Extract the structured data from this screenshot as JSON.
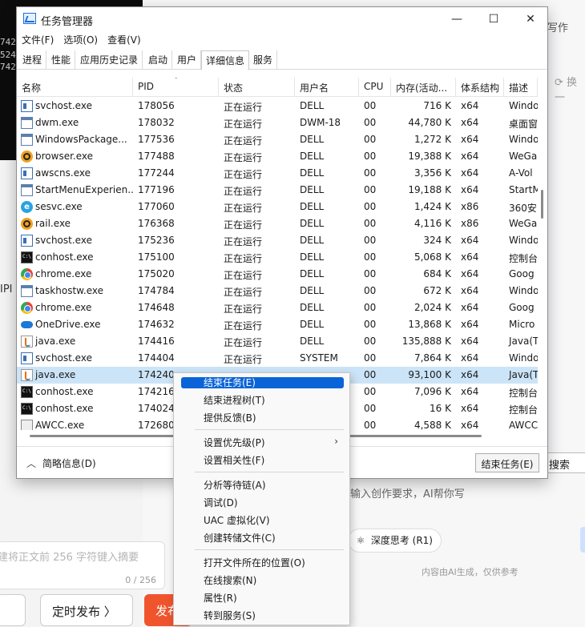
{
  "background": {
    "terminal_lines": [
      "742",
      "5242",
      "742"
    ],
    "write_label": "写作",
    "change_label": "换一",
    "side_text": "IPI",
    "search_label": "搜索",
    "hint": "输入创作要求，AI帮你写",
    "deep_think": "深度思考 (R1)",
    "ai_note": "内容由AI生成，仅供参考",
    "textarea_placeholder": "建将正文前 256 字符键入摘要",
    "textarea_count": "0 / 256",
    "schedule_btn": "定时发布 〉",
    "publish_btn": "发布"
  },
  "window": {
    "title": "任务管理器",
    "minimize": "—",
    "maximize": "☐",
    "close": "✕",
    "menu": [
      "文件(F)",
      "选项(O)",
      "查看(V)"
    ],
    "tabs": [
      "进程",
      "性能",
      "应用历史记录",
      "启动",
      "用户",
      "详细信息",
      "服务"
    ],
    "active_tab": "详细信息"
  },
  "table": {
    "columns": [
      "名称",
      "PID",
      "状态",
      "用户名",
      "CPU",
      "内存(活动...",
      "体系结构",
      "描述"
    ],
    "rows": [
      {
        "icon": "svc",
        "name": "svchost.exe",
        "pid": "178056",
        "status": "正在运行",
        "user": "DELL",
        "cpu": "00",
        "mem": "716 K",
        "arch": "x64",
        "desc": "Windo"
      },
      {
        "icon": "app",
        "name": "dwm.exe",
        "pid": "178032",
        "status": "正在运行",
        "user": "DWM-18",
        "cpu": "00",
        "mem": "44,780 K",
        "arch": "x64",
        "desc": "桌面窗"
      },
      {
        "icon": "app",
        "name": "WindowsPackage...",
        "pid": "177536",
        "status": "正在运行",
        "user": "DELL",
        "cpu": "00",
        "mem": "1,272 K",
        "arch": "x64",
        "desc": "Windo"
      },
      {
        "icon": "browser",
        "name": "browser.exe",
        "pid": "177488",
        "status": "正在运行",
        "user": "DELL",
        "cpu": "00",
        "mem": "19,388 K",
        "arch": "x64",
        "desc": "WeGa"
      },
      {
        "icon": "svc",
        "name": "awscns.exe",
        "pid": "177244",
        "status": "正在运行",
        "user": "DELL",
        "cpu": "00",
        "mem": "3,356 K",
        "arch": "x64",
        "desc": "A-Vol"
      },
      {
        "icon": "app",
        "name": "StartMenuExperien...",
        "pid": "177196",
        "status": "正在运行",
        "user": "DELL",
        "cpu": "00",
        "mem": "19,188 K",
        "arch": "x64",
        "desc": "StartM"
      },
      {
        "icon": "c360",
        "name": "sesvc.exe",
        "pid": "177060",
        "status": "正在运行",
        "user": "DELL",
        "cpu": "00",
        "mem": "1,424 K",
        "arch": "x86",
        "desc": "360安"
      },
      {
        "icon": "browser",
        "name": "rail.exe",
        "pid": "176368",
        "status": "正在运行",
        "user": "DELL",
        "cpu": "00",
        "mem": "4,116 K",
        "arch": "x86",
        "desc": "WeGa"
      },
      {
        "icon": "svc",
        "name": "svchost.exe",
        "pid": "175236",
        "status": "正在运行",
        "user": "DELL",
        "cpu": "00",
        "mem": "324 K",
        "arch": "x64",
        "desc": "Windo"
      },
      {
        "icon": "con",
        "name": "conhost.exe",
        "pid": "175100",
        "status": "正在运行",
        "user": "DELL",
        "cpu": "00",
        "mem": "5,068 K",
        "arch": "x64",
        "desc": "控制台"
      },
      {
        "icon": "chrome",
        "name": "chrome.exe",
        "pid": "175020",
        "status": "正在运行",
        "user": "DELL",
        "cpu": "00",
        "mem": "684 K",
        "arch": "x64",
        "desc": "Goog"
      },
      {
        "icon": "app",
        "name": "taskhostw.exe",
        "pid": "174784",
        "status": "正在运行",
        "user": "DELL",
        "cpu": "00",
        "mem": "672 K",
        "arch": "x64",
        "desc": "Windo"
      },
      {
        "icon": "chrome",
        "name": "chrome.exe",
        "pid": "174648",
        "status": "正在运行",
        "user": "DELL",
        "cpu": "00",
        "mem": "2,024 K",
        "arch": "x64",
        "desc": "Goog"
      },
      {
        "icon": "cloud",
        "name": "OneDrive.exe",
        "pid": "174632",
        "status": "正在运行",
        "user": "DELL",
        "cpu": "00",
        "mem": "13,868 K",
        "arch": "x64",
        "desc": "Micro"
      },
      {
        "icon": "java",
        "name": "java.exe",
        "pid": "174416",
        "status": "正在运行",
        "user": "DELL",
        "cpu": "00",
        "mem": "135,888 K",
        "arch": "x64",
        "desc": "Java(T"
      },
      {
        "icon": "svc",
        "name": "svchost.exe",
        "pid": "174404",
        "status": "正在运行",
        "user": "SYSTEM",
        "cpu": "00",
        "mem": "7,864 K",
        "arch": "x64",
        "desc": "Windo"
      },
      {
        "icon": "java",
        "name": "java.exe",
        "pid": "174240",
        "status": "",
        "user": "",
        "cpu": "00",
        "mem": "93,100 K",
        "arch": "x64",
        "desc": "Java(T",
        "selected": true
      },
      {
        "icon": "con",
        "name": "conhost.exe",
        "pid": "174216",
        "status": "",
        "user": "",
        "cpu": "00",
        "mem": "7,096 K",
        "arch": "x64",
        "desc": "控制台"
      },
      {
        "icon": "con",
        "name": "conhost.exe",
        "pid": "174024",
        "status": "",
        "user": "",
        "cpu": "00",
        "mem": "16 K",
        "arch": "x64",
        "desc": "控制台"
      },
      {
        "icon": "awcc",
        "name": "AWCC.exe",
        "pid": "172680",
        "status": "",
        "user": "",
        "cpu": "00",
        "mem": "4,588 K",
        "arch": "x64",
        "desc": "AWCC"
      }
    ]
  },
  "footer": {
    "less_details": "简略信息(D)",
    "end_task": "结束任务(E)"
  },
  "context_menu": {
    "groups": [
      [
        "结束任务(E)",
        "结束进程树(T)",
        "提供反馈(B)"
      ],
      [
        "设置优先级(P)",
        "设置相关性(F)"
      ],
      [
        "分析等待链(A)",
        "调试(D)",
        "UAC 虚拟化(V)",
        "创建转储文件(C)"
      ],
      [
        "打开文件所在的位置(O)",
        "在线搜索(N)",
        "属性(R)",
        "转到服务(S)"
      ]
    ],
    "highlighted": "结束任务(E)",
    "submenu_arrow": "›"
  }
}
